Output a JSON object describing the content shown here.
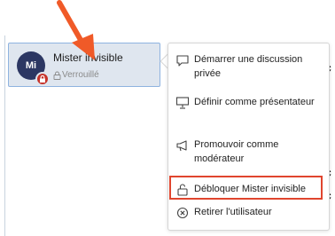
{
  "participant": {
    "initials": "Mi",
    "name": "Mister invisible",
    "status": "Verrouillé"
  },
  "menu": {
    "items": [
      {
        "label": "Démarrer une discussion privée",
        "icon": "chat-bubble-icon"
      },
      {
        "label": "Définir comme présentateur",
        "icon": "presentation-screen-icon"
      },
      {
        "label": "Promouvoir comme modérateur",
        "icon": "megaphone-icon"
      },
      {
        "label": "Débloquer Mister invisible",
        "icon": "unlock-icon"
      },
      {
        "label": "Retirer l'utilisateur",
        "icon": "remove-circle-icon"
      }
    ]
  },
  "colors": {
    "avatar": "#2c3763",
    "highlight": "#e0452e",
    "lock_badge": "#c7342b",
    "card_bg": "#dfe6ef"
  }
}
